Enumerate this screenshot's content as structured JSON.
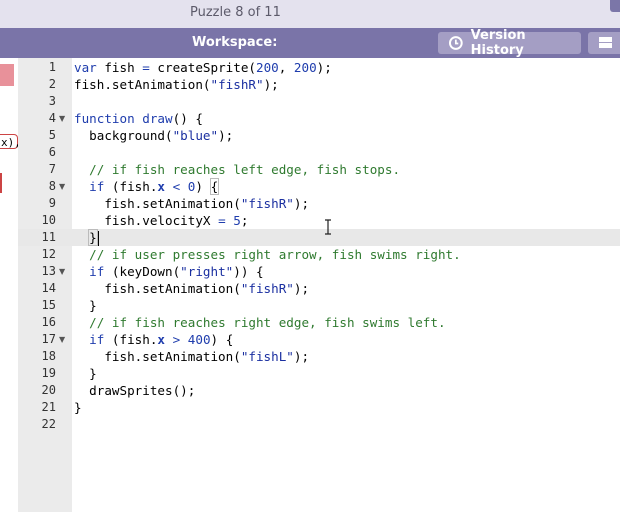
{
  "topbar": {
    "title": "Puzzle 8 of 11"
  },
  "header": {
    "title": "Workspace:",
    "version_history_label": "Version History",
    "version_history_icon": "clock-icon",
    "layout_icon": "layout-toggle-icon"
  },
  "left_panel": {
    "partial_block_text": "x),"
  },
  "editor": {
    "active_line": 11,
    "lines": [
      {
        "n": "1",
        "t": "var fish = createSprite(200, 200);"
      },
      {
        "n": "2",
        "t": "fish.setAnimation(\"fishR\");"
      },
      {
        "n": "3",
        "t": ""
      },
      {
        "n": "4",
        "t": "function draw() {",
        "fold": true
      },
      {
        "n": "5",
        "t": "  background(\"blue\");"
      },
      {
        "n": "6",
        "t": ""
      },
      {
        "n": "7",
        "t": "  // if fish reaches left edge, fish stops."
      },
      {
        "n": "8",
        "t": "  if (fish.x < 0) {",
        "fold": true
      },
      {
        "n": "9",
        "t": "    fish.setAnimation(\"fishR\");"
      },
      {
        "n": "10",
        "t": "    fish.velocityX = 5;"
      },
      {
        "n": "11",
        "t": "  }"
      },
      {
        "n": "12",
        "t": "  // if user presses right arrow, fish swims right."
      },
      {
        "n": "13",
        "t": "  if (keyDown(\"right\")) {",
        "fold": true
      },
      {
        "n": "14",
        "t": "    fish.setAnimation(\"fishR\");"
      },
      {
        "n": "15",
        "t": "  }"
      },
      {
        "n": "16",
        "t": "  // if fish reaches right edge, fish swims left."
      },
      {
        "n": "17",
        "t": "  if (fish.x > 400) {",
        "fold": true
      },
      {
        "n": "18",
        "t": "    fish.setAnimation(\"fishL\");"
      },
      {
        "n": "19",
        "t": "  }"
      },
      {
        "n": "20",
        "t": "  drawSprites();"
      },
      {
        "n": "21",
        "t": "}"
      },
      {
        "n": "22",
        "t": ""
      }
    ]
  }
}
